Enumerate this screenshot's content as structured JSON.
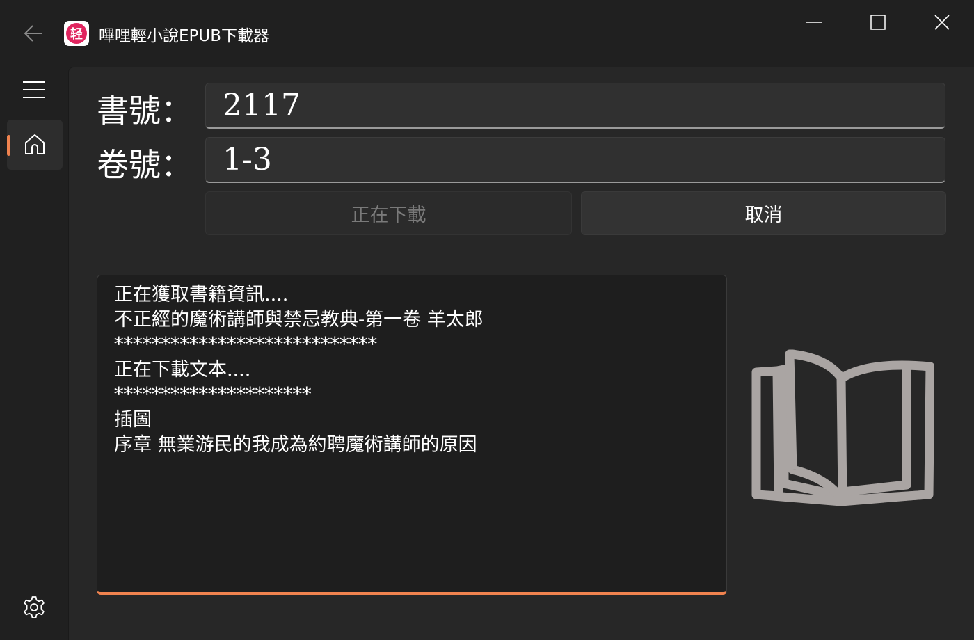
{
  "titlebar": {
    "title": "嗶哩輕小說EPUB下載器",
    "logo_glyph": "轻",
    "back_icon": "arrow-left-icon",
    "minimize_icon": "minimize-icon",
    "maximize_icon": "maximize-icon",
    "close_icon": "close-icon"
  },
  "nav": {
    "menu_icon": "hamburger-icon",
    "home_icon": "home-icon",
    "settings_icon": "gear-icon",
    "accent": "#f0834f"
  },
  "form": {
    "book_label": "書號：",
    "book_value": "2117",
    "volume_label": "卷號：",
    "volume_value": "1-3",
    "download_button": "正在下載",
    "cancel_button": "取消"
  },
  "log": {
    "lines": [
      "正在獲取書籍資訊....",
      "不正經的魔術講師與禁忌教典-第一卷 羊太郎",
      "****************************",
      "正在下載文本....",
      "*********************",
      "插圖",
      "序章 無業游民的我成為約聘魔術講師的原因"
    ],
    "progress_color": "#f0834f"
  },
  "illustration": {
    "icon": "open-book-icon",
    "color": "#aaa5a3"
  }
}
